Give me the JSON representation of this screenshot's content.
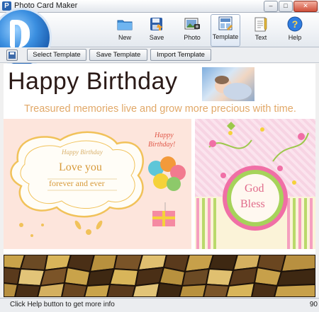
{
  "window": {
    "title": "Photo Card Maker",
    "minimize": "–",
    "maximize": "□",
    "close": "✕"
  },
  "toolbar": {
    "items": [
      {
        "label": "New",
        "icon": "folder-icon"
      },
      {
        "label": "Save",
        "icon": "save-icon"
      },
      {
        "label": "Photo",
        "icon": "photo-icon"
      },
      {
        "label": "Template",
        "icon": "template-icon",
        "active": true
      },
      {
        "label": "Text",
        "icon": "text-icon"
      },
      {
        "label": "Help",
        "icon": "help-icon"
      }
    ]
  },
  "subtoolbar": {
    "select_template": "Select Template",
    "save_template": "Save Template",
    "import_template": "Import Template"
  },
  "canvas": {
    "heading": "Happy Birthday",
    "subtitle": "Treasured memories live and grow more precious with time.",
    "left_card": {
      "small_text": "Happy Birthday",
      "main_text": "Love you",
      "sub_text": "forever and ever",
      "corner_text_1": "Happy",
      "corner_text_2": "Birthday!"
    },
    "right_card": {
      "line1": "God",
      "line2": "Bless"
    }
  },
  "status": {
    "message": "Click Help button to get more info",
    "right": "90"
  },
  "colors": {
    "subtitle": "#e1a868",
    "heading": "#2b1a17",
    "accent": "#2a64b0"
  }
}
